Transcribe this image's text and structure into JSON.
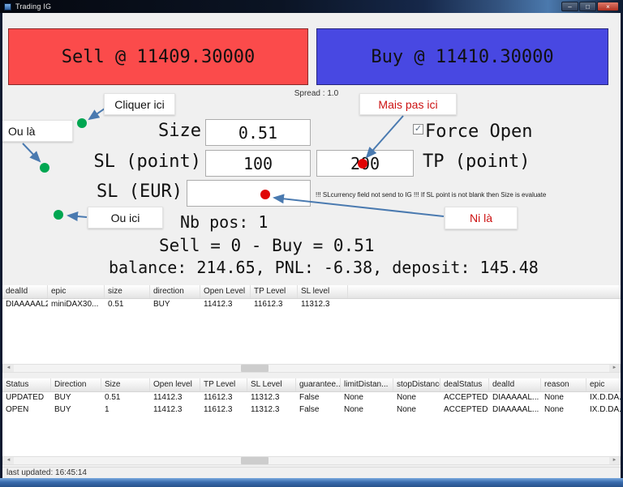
{
  "window": {
    "title": "Trading IG",
    "min_icon": "–",
    "max_icon": "□",
    "close_icon": "×"
  },
  "trade": {
    "sell_label": "Sell @ 11409.30000",
    "buy_label": "Buy @ 11410.30000",
    "spread": "Spread : 1.0"
  },
  "form": {
    "size": {
      "label": "Size",
      "value": "0.51"
    },
    "sl_point": {
      "label": "SL (point)",
      "value": "100"
    },
    "tp_point": {
      "label": "TP (point)",
      "value": "200"
    },
    "force_open": {
      "label": "Force Open",
      "checked": true
    },
    "sl_eur": {
      "label": "SL (EUR)",
      "value": ""
    },
    "warning": "!!! SLcurrency field not send to IG !!! If SL point is not blank then Size is evaluate",
    "nb_pos": "Nb pos: 1",
    "summary": "Sell = 0 - Buy = 0.51",
    "balance": "balance: 214.65, PNL: -6.38, deposit: 145.48"
  },
  "annotations": {
    "cliquer_ici": "Cliquer ici",
    "ou_la": "Ou là",
    "mais_pas_ici": "Mais pas ici",
    "ou_ici": "Ou ici",
    "ni_la": "Ni là"
  },
  "positions_table": {
    "columns": [
      "dealId",
      "epic",
      "size",
      "direction",
      "Open Level",
      "TP Level",
      "SL level"
    ],
    "rows": [
      [
        "DIAAAAAL2...",
        "miniDAX30...",
        "0.51",
        "BUY",
        "11412.3",
        "11612.3",
        "11312.3"
      ]
    ]
  },
  "status_table": {
    "columns": [
      "Status",
      "Direction",
      "Size",
      "Open level",
      "TP Level",
      "SL Level",
      "guarantee...",
      "limitDistan...",
      "stopDistance",
      "dealStatus",
      "dealId",
      "reason",
      "epic"
    ],
    "rows": [
      [
        "UPDATED",
        "BUY",
        "0.51",
        "11412.3",
        "11612.3",
        "11312.3",
        "False",
        "None",
        "None",
        "ACCEPTED",
        "DIAAAAAL...",
        "None",
        "IX.D.DA..."
      ],
      [
        "OPEN",
        "BUY",
        "1",
        "11412.3",
        "11612.3",
        "11312.3",
        "False",
        "None",
        "None",
        "ACCEPTED",
        "DIAAAAAL...",
        "None",
        "IX.D.DA..."
      ]
    ]
  },
  "status_bar": {
    "last_updated": "last updated: 16:45:14"
  },
  "icons": {
    "check": "✓",
    "scroll_left": "◄",
    "scroll_right": "►"
  },
  "colors": {
    "sell_red": "#fb4b4b",
    "buy_blue": "#4848e2",
    "marker_green": "#00a651",
    "marker_red": "#e00505",
    "arrow_blue": "#4a7ab0",
    "annotation_red_text": "#cc1111"
  }
}
